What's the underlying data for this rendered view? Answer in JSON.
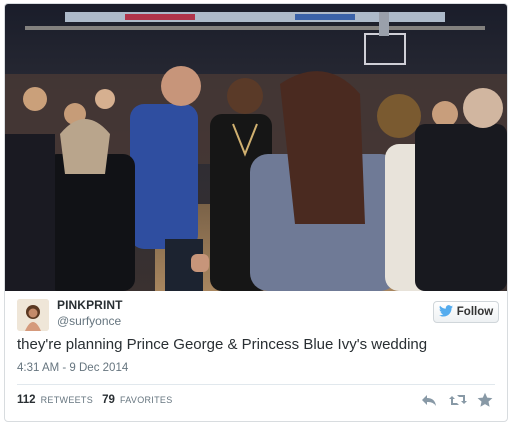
{
  "tweet": {
    "display_name": "PINKPRINT",
    "handle": "@surfyonce",
    "text": "they're planning Prince George & Princess Blue Ivy's wedding",
    "timestamp": "4:31 AM - 9 Dec 2014",
    "follow_label": "Follow",
    "retweets_count": "112",
    "retweets_label": "RETWEETS",
    "favorites_count": "79",
    "favorites_label": "FAVORITES"
  },
  "icons": {
    "follow": "twitter-bird-icon",
    "reply": "reply-icon",
    "retweet": "retweet-icon",
    "favorite": "star-icon"
  },
  "colors": {
    "twitter_blue": "#55acee",
    "text": "#292f33",
    "muted": "#66757f"
  }
}
